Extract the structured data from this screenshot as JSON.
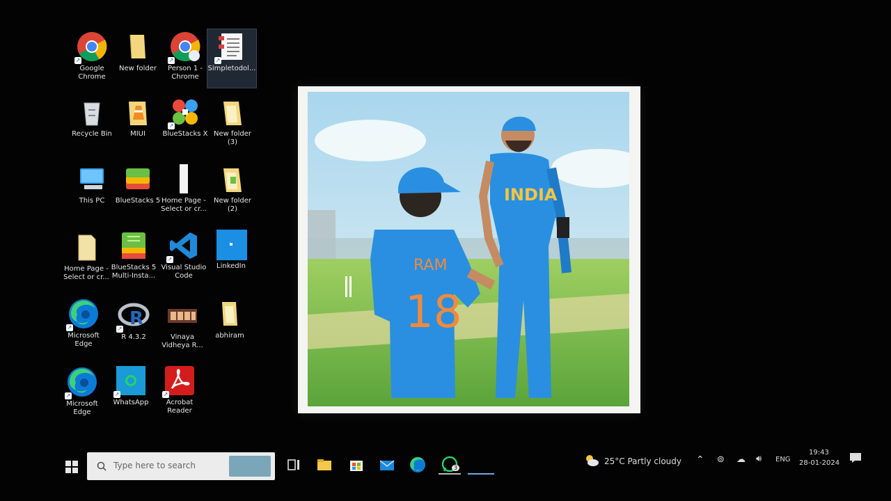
{
  "desktop": {
    "icons": [
      {
        "label": "Google\nChrome"
      },
      {
        "label": "New folder"
      },
      {
        "label": "Person 1 -\nChrome"
      },
      {
        "label": "Simpletodol..."
      },
      {
        "label": "Recycle Bin"
      },
      {
        "label": "MIUI"
      },
      {
        "label": "BlueStacks X"
      },
      {
        "label": "New folder\n(3)"
      },
      {
        "label": "This PC"
      },
      {
        "label": "BlueStacks 5"
      },
      {
        "label": "Home Page -\nSelect or cr..."
      },
      {
        "label": "New folder\n(2)"
      },
      {
        "label": "Home Page -\nSelect or cr..."
      },
      {
        "label": "BlueStacks 5\nMulti-Insta..."
      },
      {
        "label": "Visual Studio\nCode"
      },
      {
        "label": "LinkedIn"
      },
      {
        "label": "Microsoft\nEdge"
      },
      {
        "label": "R 4.3.2"
      },
      {
        "label": "Vinaya\nVidheya R..."
      },
      {
        "label": "abhiram"
      },
      {
        "label": "Microsoft\nEdge"
      },
      {
        "label": "WhatsApp"
      },
      {
        "label": "Acrobat\nReader"
      }
    ]
  },
  "wallpaper": {
    "jersey_name": "RAM",
    "jersey_number": "18",
    "shirt_text": "INDIA"
  },
  "taskbar": {
    "search_placeholder": "Type here to search",
    "whatsapp_badge": "3",
    "weather": "25°C  Partly cloudy",
    "language": "ENG",
    "time": "19:43",
    "date": "28-01-2024"
  },
  "colors": {
    "desktop_bg": "#030303",
    "taskbar_text": "#dcdcdc",
    "jersey_blue": "#2a8fe0",
    "jersey_orange": "#f08a3c"
  }
}
